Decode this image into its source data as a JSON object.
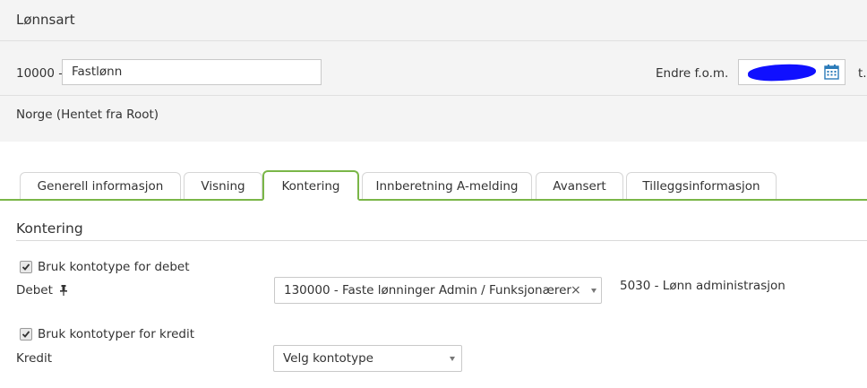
{
  "header": {
    "title": "Lønnsart"
  },
  "wage": {
    "code_label": "10000 -",
    "name_value": "Fastlønn",
    "change_from_label": "Endre f.o.m.",
    "to_label_fragment": "t.",
    "origin": "Norge (Hentet fra Root)"
  },
  "tabs": [
    {
      "label": "Generell informasjon"
    },
    {
      "label": "Visning"
    },
    {
      "label": "Kontering"
    },
    {
      "label": "Innberetning A-melding"
    },
    {
      "label": "Avansert"
    },
    {
      "label": "Tilleggsinformasjon"
    }
  ],
  "active_tab": "Kontering",
  "kontering": {
    "title": "Kontering",
    "debit_checkbox_label": "Bruk kontotype for debet",
    "debit_checkbox_checked": true,
    "debit_label": "Debet",
    "debit_select_value": "130000 - Faste lønninger Admin / Funksjonærer",
    "debit_account": "5030 - Lønn administrasjon",
    "credit_checkbox_label": "Bruk kontotyper for kredit",
    "credit_checkbox_checked": true,
    "credit_label": "Kredit",
    "credit_select_value": "Velg kontotype"
  },
  "colors": {
    "accent": "#7ab648",
    "band": "#f4f4f4",
    "redaction": "#1010ff"
  }
}
